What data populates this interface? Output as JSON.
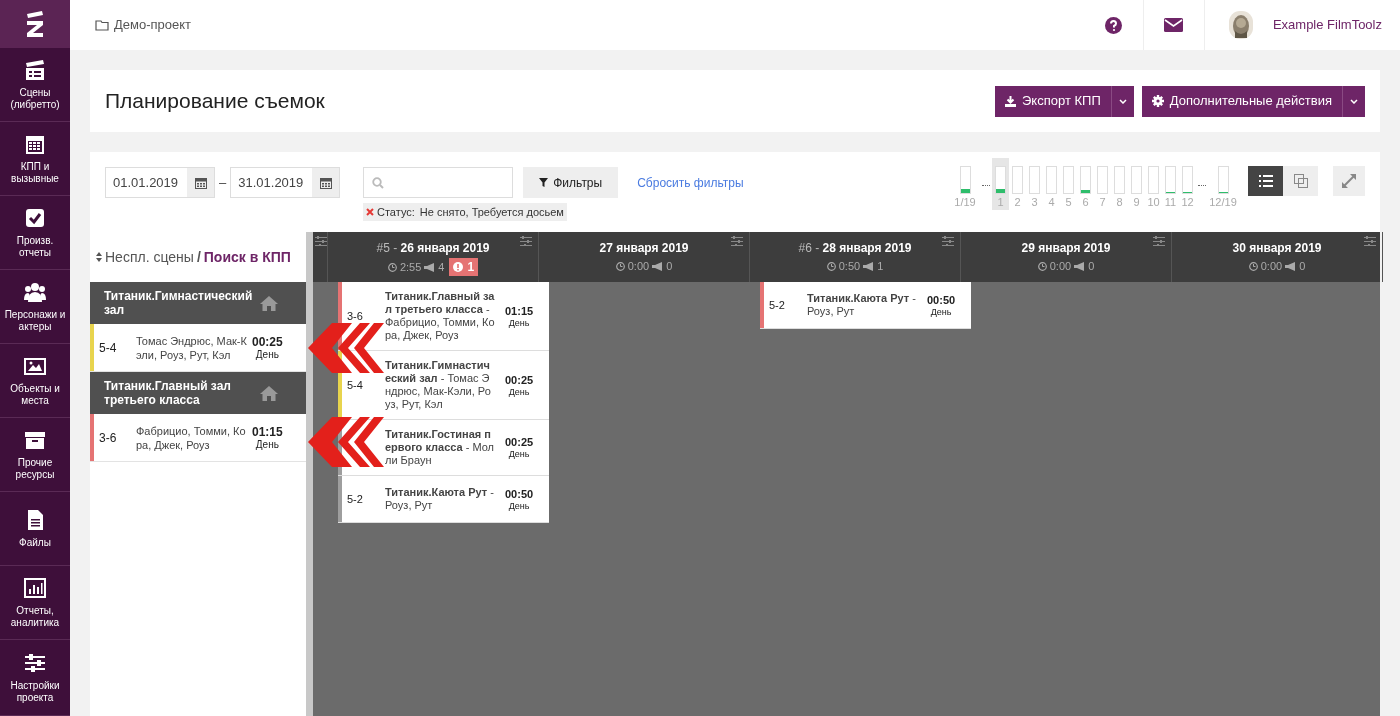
{
  "sidebar": {
    "items": [
      {
        "label": "Сцены (либретто)"
      },
      {
        "label": "КПП и вызывные"
      },
      {
        "label": "Произв. отчеты"
      },
      {
        "label": "Персонажи и актеры"
      },
      {
        "label": "Объекты и места"
      },
      {
        "label": "Прочие ресурсы"
      },
      {
        "label": "Файлы"
      },
      {
        "label": "Отчеты, аналитика"
      },
      {
        "label": "Настройки проекта"
      }
    ]
  },
  "topbar": {
    "breadcrumb": "Демо-проект",
    "user": "Example FilmToolz"
  },
  "page": {
    "title": "Планирование съемок",
    "buttons": [
      "Экспорт КПП",
      "Дополнительные действия"
    ]
  },
  "filters": {
    "date_from": "01.01.2019",
    "date_to": "31.01.2019",
    "dash": "–",
    "filter_button": "Фильтры",
    "reset_link": "Сбросить фильтры",
    "chip_label": "Статус:",
    "chip_value": "Не снято, Требуется досьем"
  },
  "timeline": [
    {
      "label": "1/19",
      "level": 0.15,
      "selected": false,
      "gap_after": true
    },
    {
      "label": "1",
      "level": 0.15,
      "selected": true,
      "gap_after": false
    },
    {
      "label": "2",
      "selected": false,
      "gap_after": false
    },
    {
      "label": "3",
      "selected": false,
      "gap_after": false
    },
    {
      "label": "4",
      "selected": false,
      "gap_after": false
    },
    {
      "label": "5",
      "selected": false,
      "gap_after": false
    },
    {
      "label": "6",
      "level": 0.12,
      "selected": false,
      "gap_after": false
    },
    {
      "label": "7",
      "selected": false,
      "gap_after": false
    },
    {
      "label": "8",
      "selected": false,
      "gap_after": false
    },
    {
      "label": "9",
      "selected": false,
      "gap_after": false
    },
    {
      "label": "10",
      "selected": false,
      "gap_after": false
    },
    {
      "label": "11",
      "level": 0.03,
      "selected": false,
      "gap_after": false
    },
    {
      "label": "12",
      "level": 0.03,
      "selected": false,
      "gap_after": true
    },
    {
      "label": "12/19",
      "level": 0.03,
      "selected": false,
      "gap_after": false
    }
  ],
  "view_modes": [
    {
      "selected": true
    },
    {
      "selected": false
    }
  ],
  "unplanned": {
    "title": "Неспл. сцены",
    "separator": "/",
    "link": "Поиск в КПП",
    "groups": [
      {
        "location": "Титаник.Гимнастический зал",
        "scenes": [
          {
            "number": "5-4",
            "color": "#e8d44d",
            "cast": "Томас Эндрюс, Мак-Кэли, Роуз, Рут, Кэл",
            "duration": "00:25",
            "time": "День"
          }
        ]
      },
      {
        "location": "Титаник.Главный зал третьего класса",
        "scenes": [
          {
            "number": "3-6",
            "color": "#e57373",
            "cast": "Фабрицио, Томми, Кора, Джек, Роуз",
            "duration": "01:15",
            "time": "День"
          }
        ]
      }
    ]
  },
  "days": [
    {
      "shoot": "#5",
      "dash": "-",
      "date": "26 января 2019",
      "duration": "2:55",
      "count": "4",
      "alert": "1",
      "scenes": [
        {
          "number": "3-6",
          "color": "#e57373",
          "text": "**Титаник.Главный зал третьего класса** - Фабрицио, Томми, Кора, Джек, Роуз",
          "duration": "01:15",
          "time": "День"
        },
        {
          "number": "5-4",
          "color": "#e8d44d",
          "text": "**Титаник.Гимнастический зал** - Томас Эндрюс, Мак-Кэли, Роуз, Рут, Кэл",
          "duration": "00:25",
          "time": "День"
        },
        {
          "color": "#9e9e9e",
          "text": "**Титаник.Гостиная первого класса** - Молли Браун",
          "duration": "00:25",
          "time": "День"
        },
        {
          "number": "5-2",
          "color": "#9e9e9e",
          "text": "**Титаник.Каюта Рут** - Роуз, Рут",
          "duration": "00:50",
          "time": "День"
        }
      ]
    },
    {
      "date": "27 января 2019",
      "duration": "0:00",
      "count": "0"
    },
    {
      "shoot": "#6",
      "dash": "-",
      "date": "28 января 2019",
      "duration": "0:50",
      "count": "1",
      "scenes": [
        {
          "number": "5-2",
          "color": "#e57373",
          "text": "**Титаник.Каюта Рут** - Роуз, Рут",
          "duration": "00:50",
          "time": "День"
        }
      ]
    },
    {
      "date": "29 января 2019",
      "duration": "0:00",
      "count": "0"
    },
    {
      "date": "30 января 2019",
      "duration": "0:00",
      "count": "0"
    }
  ]
}
